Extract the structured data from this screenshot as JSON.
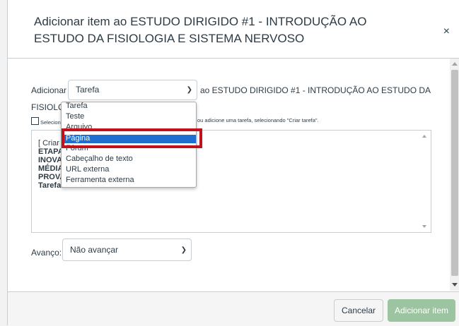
{
  "modal": {
    "title": "Adicionar item ao ESTUDO DIRIGIDO #1 - INTRODUÇÃO AO ESTUDO DA FISIOLOGIA E SISTEMA NERVOSO",
    "close": "×"
  },
  "form": {
    "add_label": "Adicionar",
    "type_value": "Tarefa",
    "to_text": "ao ESTUDO DIRIGIDO #1 - INTRODUÇÃO AO ESTUDO DA",
    "wrap_text": "FISIOLOG",
    "hint_left": "Selecione",
    "hint_right": "ou adicione uma tarefa, selecionando \"Criar tarefa\".",
    "list_items": [
      {
        "label": "[ Criar",
        "bold": false
      },
      {
        "label": "ETAPA L",
        "bold": true
      },
      {
        "label": "INOVA",
        "bold": true
      },
      {
        "label": "MÉDIA I",
        "bold": true
      },
      {
        "label": "PROVA I",
        "bold": true
      },
      {
        "label": "Tarefas",
        "bold": true
      }
    ],
    "advance_label": "Avanço:",
    "advance_value": "Não avançar"
  },
  "dropdown": {
    "options": [
      "Tarefa",
      "Teste",
      "Arquivo",
      "Página",
      "Fórum",
      "Cabeçalho de texto",
      "URL externa",
      "Ferramenta externa"
    ],
    "selected": "Página"
  },
  "footer": {
    "cancel_label": "Cancelar",
    "add_label": "Adicionar item"
  },
  "colors": {
    "selected_option": "#1f6fd1",
    "highlight_border": "#c1121c",
    "add_button": "#9cc4a0"
  }
}
